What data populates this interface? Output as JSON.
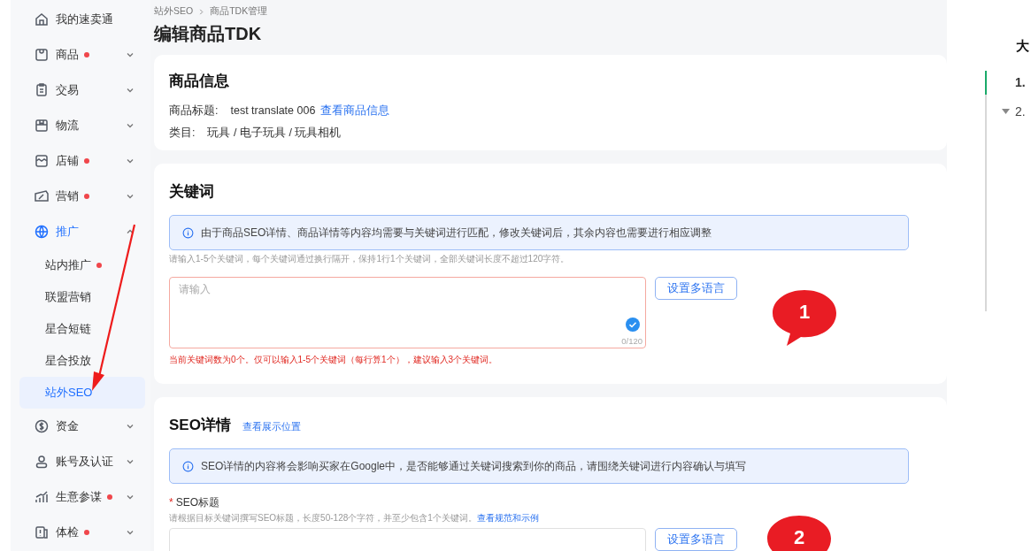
{
  "sidebar": {
    "items": [
      {
        "label": "我的速卖通",
        "dot": false
      },
      {
        "label": "商品",
        "dot": true,
        "expanded": false
      },
      {
        "label": "交易",
        "dot": false,
        "expanded": false
      },
      {
        "label": "物流",
        "dot": false,
        "expanded": false
      },
      {
        "label": "店铺",
        "dot": true,
        "expanded": false
      },
      {
        "label": "营销",
        "dot": true,
        "expanded": false
      },
      {
        "label": "推广",
        "dot": false,
        "expanded": true,
        "selected": true,
        "children": [
          {
            "label": "站内推广",
            "dot": true,
            "selected": false
          },
          {
            "label": "联盟营销",
            "dot": false,
            "selected": false
          },
          {
            "label": "星合短链",
            "dot": false,
            "selected": false
          },
          {
            "label": "星合投放",
            "dot": false,
            "selected": false
          },
          {
            "label": "站外SEO",
            "dot": false,
            "selected": true
          }
        ]
      },
      {
        "label": "资金",
        "dot": false,
        "expanded": false
      },
      {
        "label": "账号及认证",
        "dot": false,
        "expanded": false
      },
      {
        "label": "生意参谋",
        "dot": true,
        "expanded": false
      },
      {
        "label": "体检",
        "dot": true,
        "expanded": false
      }
    ]
  },
  "breadcrumb": [
    "站外SEO",
    "商品TDK管理"
  ],
  "page_title": "编辑商品TDK",
  "product_info": {
    "title": "商品信息",
    "fields": [
      {
        "label": "商品标题:",
        "value": "test translate 006",
        "link": "查看商品信息"
      },
      {
        "label": "类目:",
        "value": "玩具 / 电子玩具 / 玩具相机"
      }
    ]
  },
  "keywords": {
    "title": "关键词",
    "notice": "由于商品SEO详情、商品详情等内容均需要与关键词进行匹配，修改关键词后，其余内容也需要进行相应调整",
    "hint": "请输入1-5个关键词，每个关键词通过换行隔开，保持1行1个关键词，全部关键词长度不超过120字符。",
    "placeholder": "请输入",
    "counter": "0/120",
    "error": true,
    "error_text": "当前关键词数为0个。仅可以输入1-5个关键词（每行算1个），建议输入3个关键词。",
    "button": "设置多语言"
  },
  "seo_details": {
    "title": "SEO详情",
    "link": "查看展示位置",
    "notice": "SEO详情的内容将会影响买家在Google中，是否能够通过关键词搜索到你的商品，请围绕关键词进行内容确认与填写",
    "field_label": "SEO标题",
    "required_mark": "*",
    "hint": "请根据目标关键词撰写SEO标题，长度50-128个字符，并至少包含1个关键词。",
    "hint_link": "查看规范和示例",
    "button": "设置多语言"
  },
  "callouts": [
    "1",
    "2"
  ],
  "outline": {
    "title": "大",
    "items": [
      {
        "label": "1.",
        "selected": true,
        "collapsible": false
      },
      {
        "label": "2.",
        "selected": false,
        "collapsible": true
      }
    ]
  }
}
